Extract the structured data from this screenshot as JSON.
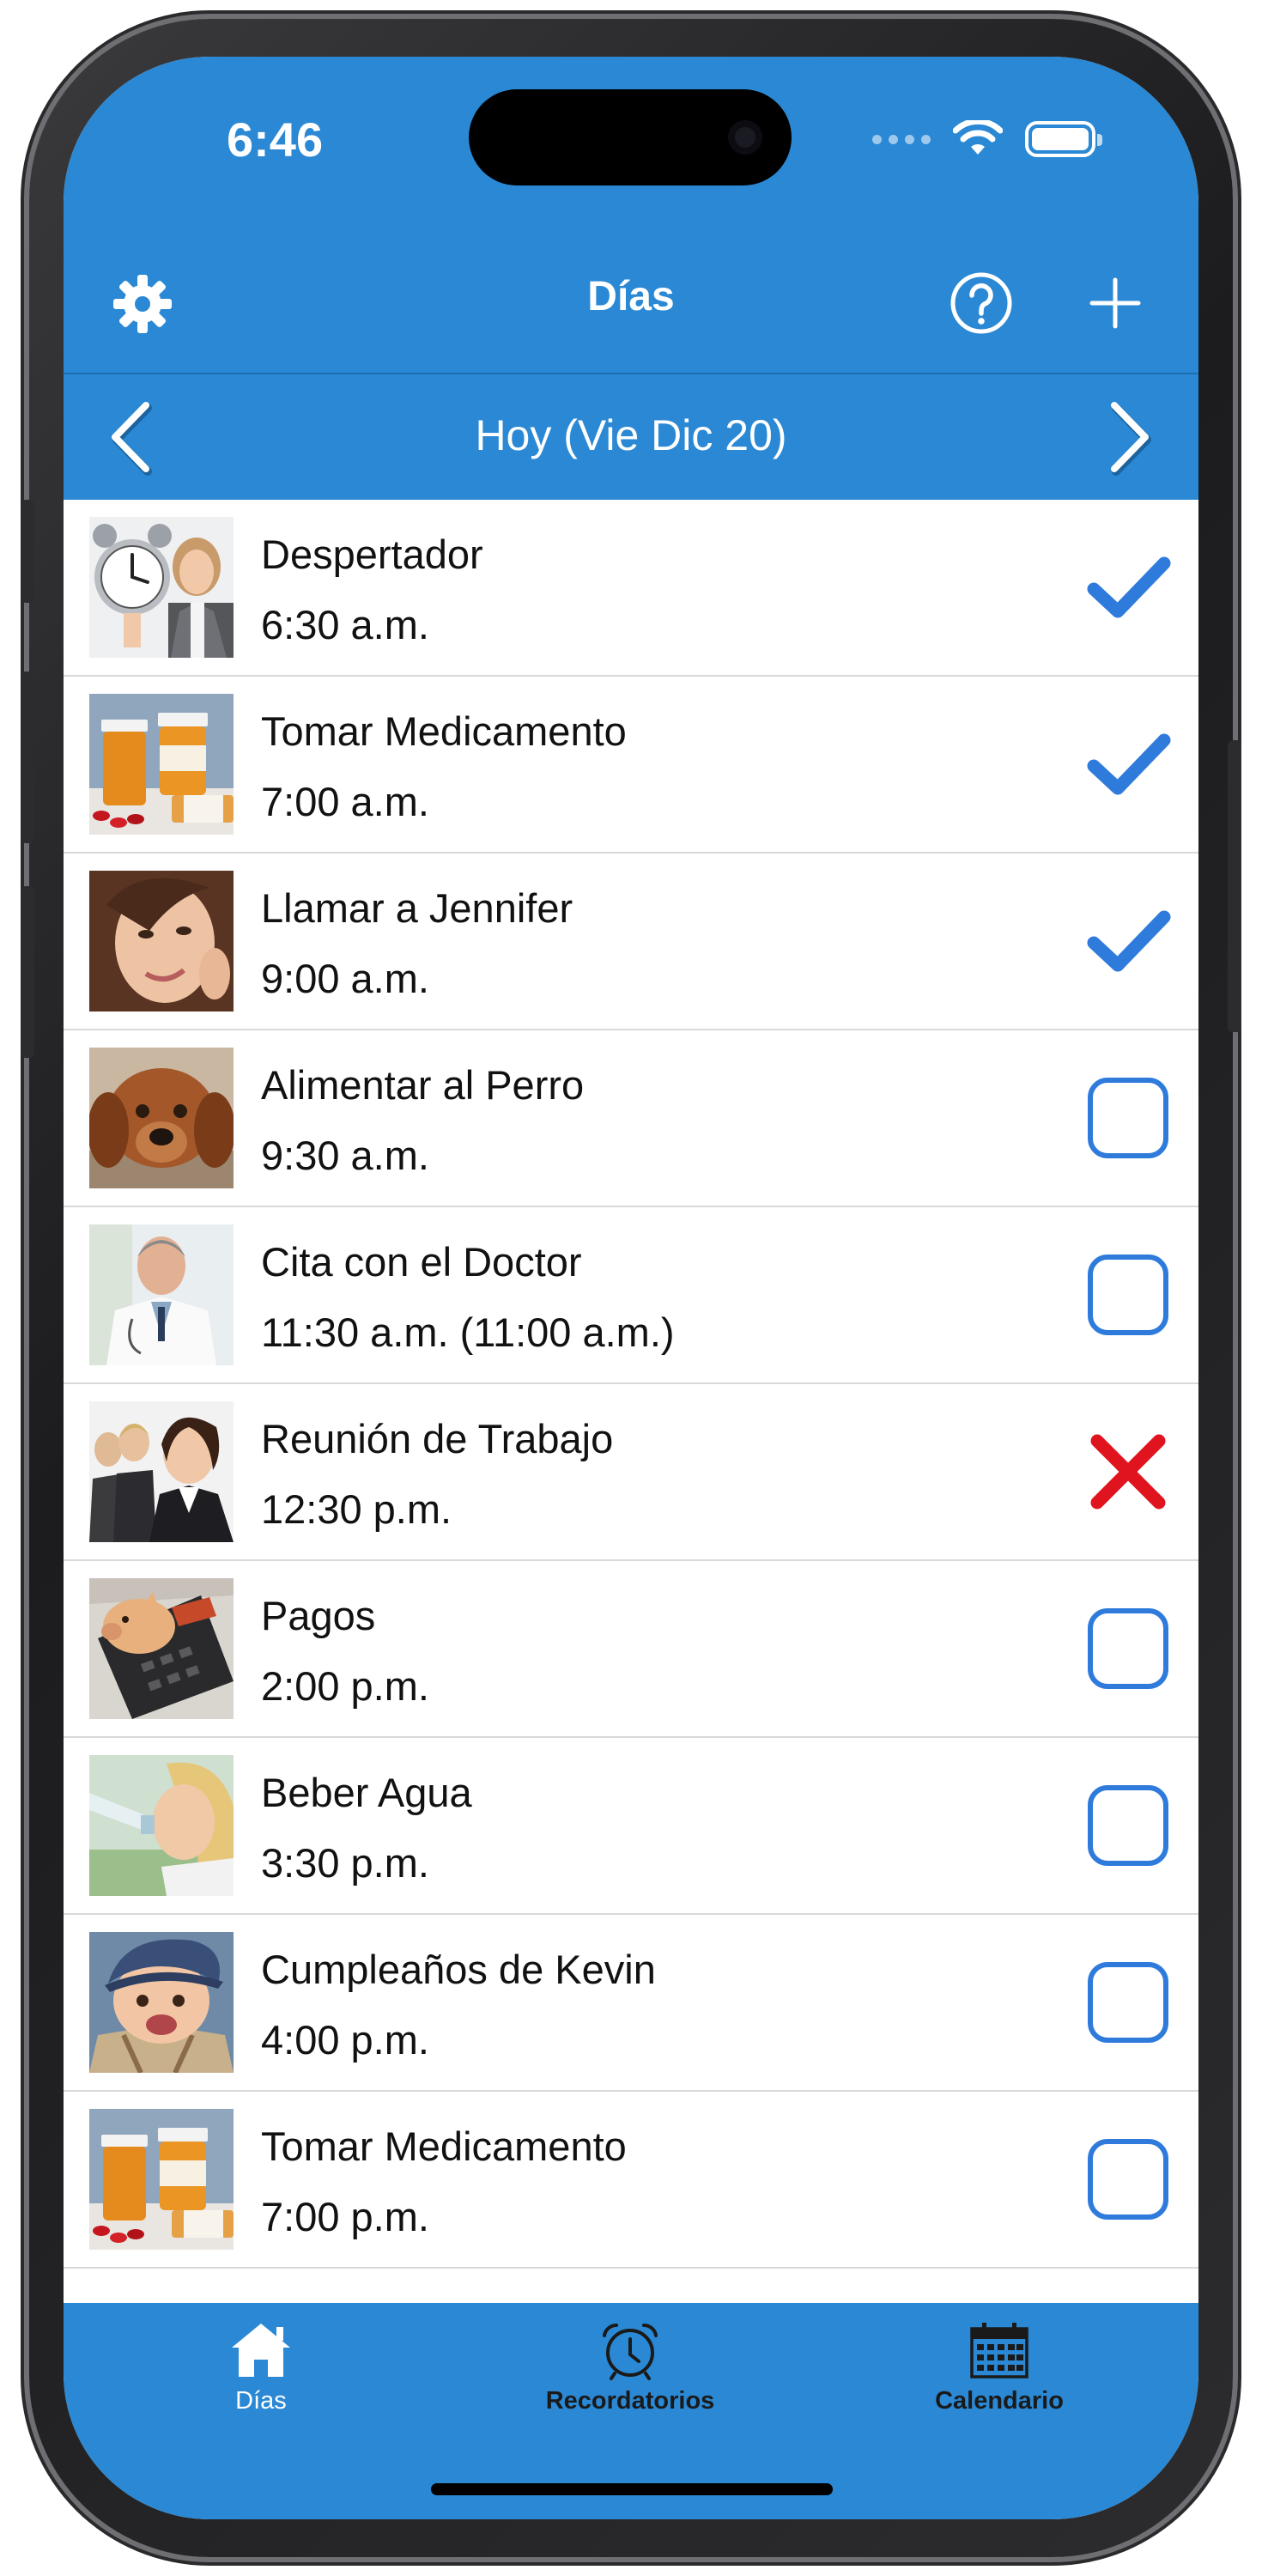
{
  "status_bar": {
    "time": "6:46"
  },
  "nav": {
    "title": "Días"
  },
  "date_bar": {
    "label": "Hoy (Vie Dic 20)"
  },
  "colors": {
    "primary": "#2a88d4",
    "check": "#2f7bdc",
    "cross": "#e0141e"
  },
  "reminders": [
    {
      "title": "Despertador",
      "time": "6:30 a.m.",
      "status": "done",
      "image": "alarm-clock-woman"
    },
    {
      "title": "Tomar Medicamento",
      "time": "7:00 a.m.",
      "status": "done",
      "image": "pill-bottles"
    },
    {
      "title": "Llamar a Jennifer",
      "time": "9:00 a.m.",
      "status": "done",
      "image": "woman-portrait"
    },
    {
      "title": "Alimentar al Perro",
      "time": "9:30 a.m.",
      "status": "pending",
      "image": "dog"
    },
    {
      "title": "Cita con el Doctor",
      "time": "11:30 a.m. (11:00 a.m.)",
      "status": "pending",
      "image": "doctor"
    },
    {
      "title": "Reunión de Trabajo",
      "time": "12:30 p.m.",
      "status": "missed",
      "image": "business-women"
    },
    {
      "title": "Pagos",
      "time": "2:00 p.m.",
      "status": "pending",
      "image": "piggy-calculator"
    },
    {
      "title": "Beber Agua",
      "time": "3:30 p.m.",
      "status": "pending",
      "image": "woman-drinking-water"
    },
    {
      "title": "Cumpleaños de Kevin",
      "time": "4:00 p.m.",
      "status": "pending",
      "image": "baby-cap"
    },
    {
      "title": "Tomar Medicamento",
      "time": "7:00 p.m.",
      "status": "pending",
      "image": "pill-bottles"
    }
  ],
  "tabs": [
    {
      "label": "Días",
      "icon": "house-icon",
      "active": true
    },
    {
      "label": "Recordatorios",
      "icon": "alarm-clock-icon",
      "active": false
    },
    {
      "label": "Calendario",
      "icon": "calendar-icon",
      "active": false
    }
  ]
}
